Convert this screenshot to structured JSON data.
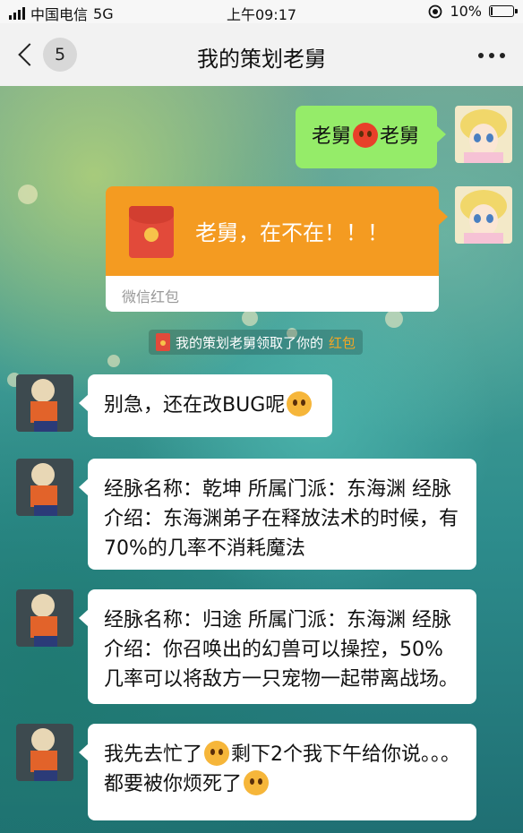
{
  "status_bar": {
    "carrier": "中国电信",
    "network": "5G",
    "time": "上午09:17",
    "battery": "10%",
    "battery_level": 0.1
  },
  "nav": {
    "unread_count": "5",
    "title": "我的策划老舅"
  },
  "messages": {
    "m1": {
      "part1": "老舅",
      "part2": "老舅"
    },
    "red_packet": {
      "text": "老舅，在不在！！！",
      "label": "微信红包"
    },
    "system": {
      "prefix": "我的策划老舅领取了你的",
      "highlight": "红包"
    },
    "m2": {
      "text": "别急，还在改BUG呢"
    },
    "m3": {
      "text": "经脉名称：乾坤 所属门派：东海渊 经脉介绍：东海渊弟子在释放法术的时候，有70%的几率不消耗魔法"
    },
    "m4": {
      "text": "经脉名称：归途 所属门派：东海渊 经脉介绍：你召唤出的幻兽可以操控，50%几率可以将敌方一只宠物一起带离战场。"
    },
    "m5": {
      "part1": "我先去忙了",
      "part2": "剩下2个我下午给你说。。。都要被你烦死了"
    }
  },
  "colors": {
    "green_bubble": "#95ec69",
    "red_packet": "#f49b21"
  }
}
